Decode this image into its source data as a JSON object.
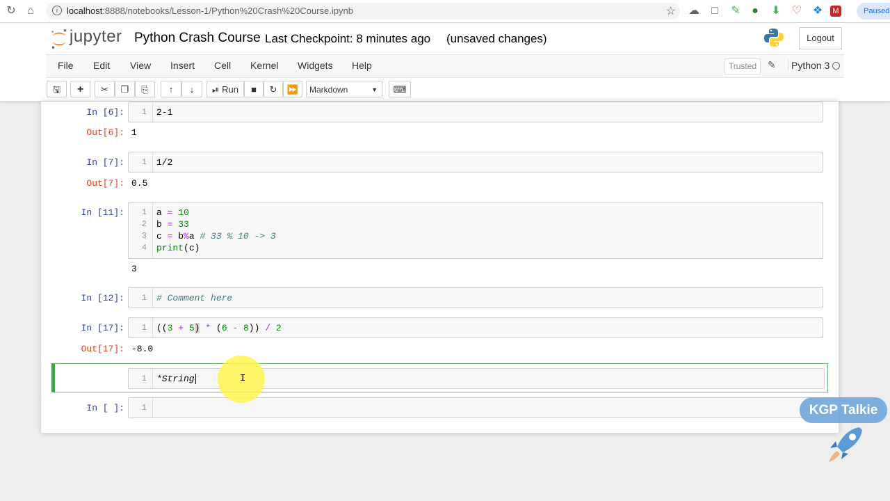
{
  "browser": {
    "url_host": "localhost",
    "url_path": ":8888/notebooks/Lesson-1/Python%20Crash%20Course.ipynb",
    "paused_label": "Paused"
  },
  "header": {
    "logo_text": "jupyter",
    "notebook_title": "Python Crash Course",
    "checkpoint": "Last Checkpoint: 8 minutes ago",
    "unsaved": "(unsaved changes)",
    "logout_label": "Logout"
  },
  "menu": {
    "items": [
      "File",
      "Edit",
      "View",
      "Insert",
      "Cell",
      "Kernel",
      "Widgets",
      "Help"
    ],
    "trusted": "Trusted",
    "kernel": "Python 3"
  },
  "toolbar": {
    "run_label": "Run",
    "cell_type": "Markdown"
  },
  "cells": {
    "c1": {
      "prompt": "In [6]:",
      "line1": "2-1",
      "out_prompt": "Out[6]:",
      "output": "1"
    },
    "c2": {
      "prompt": "In [7]:",
      "line1": "1/2",
      "out_prompt": "Out[7]:",
      "output": "0.5"
    },
    "c3": {
      "prompt": "In [11]:",
      "output": "3"
    },
    "c4": {
      "prompt": "In [12]:",
      "line1": "# Comment here"
    },
    "c5": {
      "prompt": "In [17]:",
      "out_prompt": "Out[17]:",
      "output": "-8.0"
    },
    "c6": {
      "line1": "*String"
    },
    "c7": {
      "prompt": "In [ ]:"
    }
  },
  "watermark": "KGP Talkie",
  "colors": {
    "prompt_in": "#303f9f",
    "prompt_out": "#d84315",
    "selected_border": "#42a047"
  }
}
